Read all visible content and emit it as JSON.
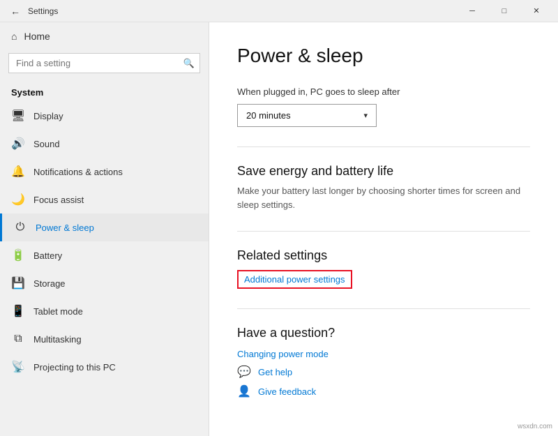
{
  "titlebar": {
    "back_label": "←",
    "title": "Settings",
    "minimize_label": "─",
    "maximize_label": "□",
    "close_label": "✕"
  },
  "sidebar": {
    "home_label": "Home",
    "search_placeholder": "Find a setting",
    "search_icon": "🔍",
    "section_label": "System",
    "items": [
      {
        "id": "display",
        "label": "Display",
        "icon": "🖥"
      },
      {
        "id": "sound",
        "label": "Sound",
        "icon": "🔊"
      },
      {
        "id": "notifications",
        "label": "Notifications & actions",
        "icon": "🔔"
      },
      {
        "id": "focus",
        "label": "Focus assist",
        "icon": "🌙"
      },
      {
        "id": "power",
        "label": "Power & sleep",
        "icon": "⏻",
        "active": true
      },
      {
        "id": "battery",
        "label": "Battery",
        "icon": "🔋"
      },
      {
        "id": "storage",
        "label": "Storage",
        "icon": "💾"
      },
      {
        "id": "tablet",
        "label": "Tablet mode",
        "icon": "📱"
      },
      {
        "id": "multitasking",
        "label": "Multitasking",
        "icon": "⧉"
      },
      {
        "id": "projecting",
        "label": "Projecting to this PC",
        "icon": "📡"
      }
    ]
  },
  "content": {
    "title": "Power & sleep",
    "sleep_section": {
      "label": "When plugged in, PC goes to sleep after",
      "selected_value": "20 minutes"
    },
    "save_energy": {
      "heading": "Save energy and battery life",
      "description": "Make your battery last longer by choosing shorter times for screen and sleep settings."
    },
    "related_settings": {
      "heading": "Related settings",
      "additional_power_label": "Additional power settings"
    },
    "have_question": {
      "heading": "Have a question?",
      "changing_power_mode": "Changing power mode",
      "get_help": "Get help",
      "give_feedback": "Give feedback"
    }
  },
  "watermark": "wsxdn.com"
}
